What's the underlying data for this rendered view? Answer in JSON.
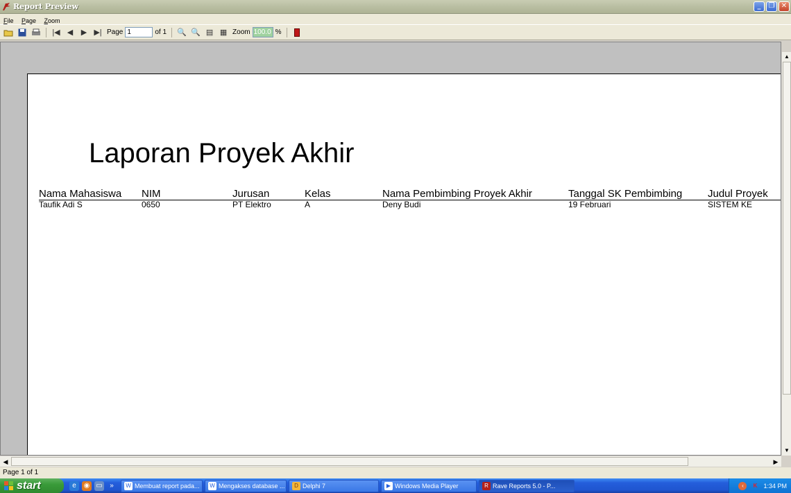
{
  "window": {
    "title": "Report Preview"
  },
  "menu": [
    {
      "label": "File",
      "u": "F",
      "rest": "ile"
    },
    {
      "label": "Page",
      "u": "P",
      "rest": "age"
    },
    {
      "label": "Zoom",
      "u": "Z",
      "rest": "oom"
    }
  ],
  "toolbar": {
    "page_label": "Page",
    "page_value": "1",
    "of_label": "of 1",
    "zoom_label": "Zoom",
    "zoom_value": "100.0",
    "percent": "%"
  },
  "report": {
    "title": "Laporan Proyek Akhir",
    "columns": [
      "Nama Mahasiswa",
      "NIM",
      "Jurusan",
      "Kelas",
      "Nama Pembimbing Proyek Akhir",
      "Tanggal SK Pembimbing",
      "Judul Proyek"
    ],
    "rows": [
      [
        "Taufik Adi S",
        "0650",
        "PT Elektro",
        "A",
        "Deny Budi",
        "19 Februari",
        "SISTEM KE"
      ]
    ]
  },
  "status": {
    "text": "Page 1 of 1"
  },
  "taskbar": {
    "start_label": "start",
    "tasks": [
      "Membuat report pada...",
      "Mengakses database ...",
      "Delphi 7",
      "Windows Media Player",
      "Rave Reports 5.0 - P..."
    ],
    "clock": "1:34 PM"
  },
  "colors": {
    "accent": "#245edb",
    "title_bar": "#b9bea2",
    "zoom_field": "#9fd29f"
  }
}
